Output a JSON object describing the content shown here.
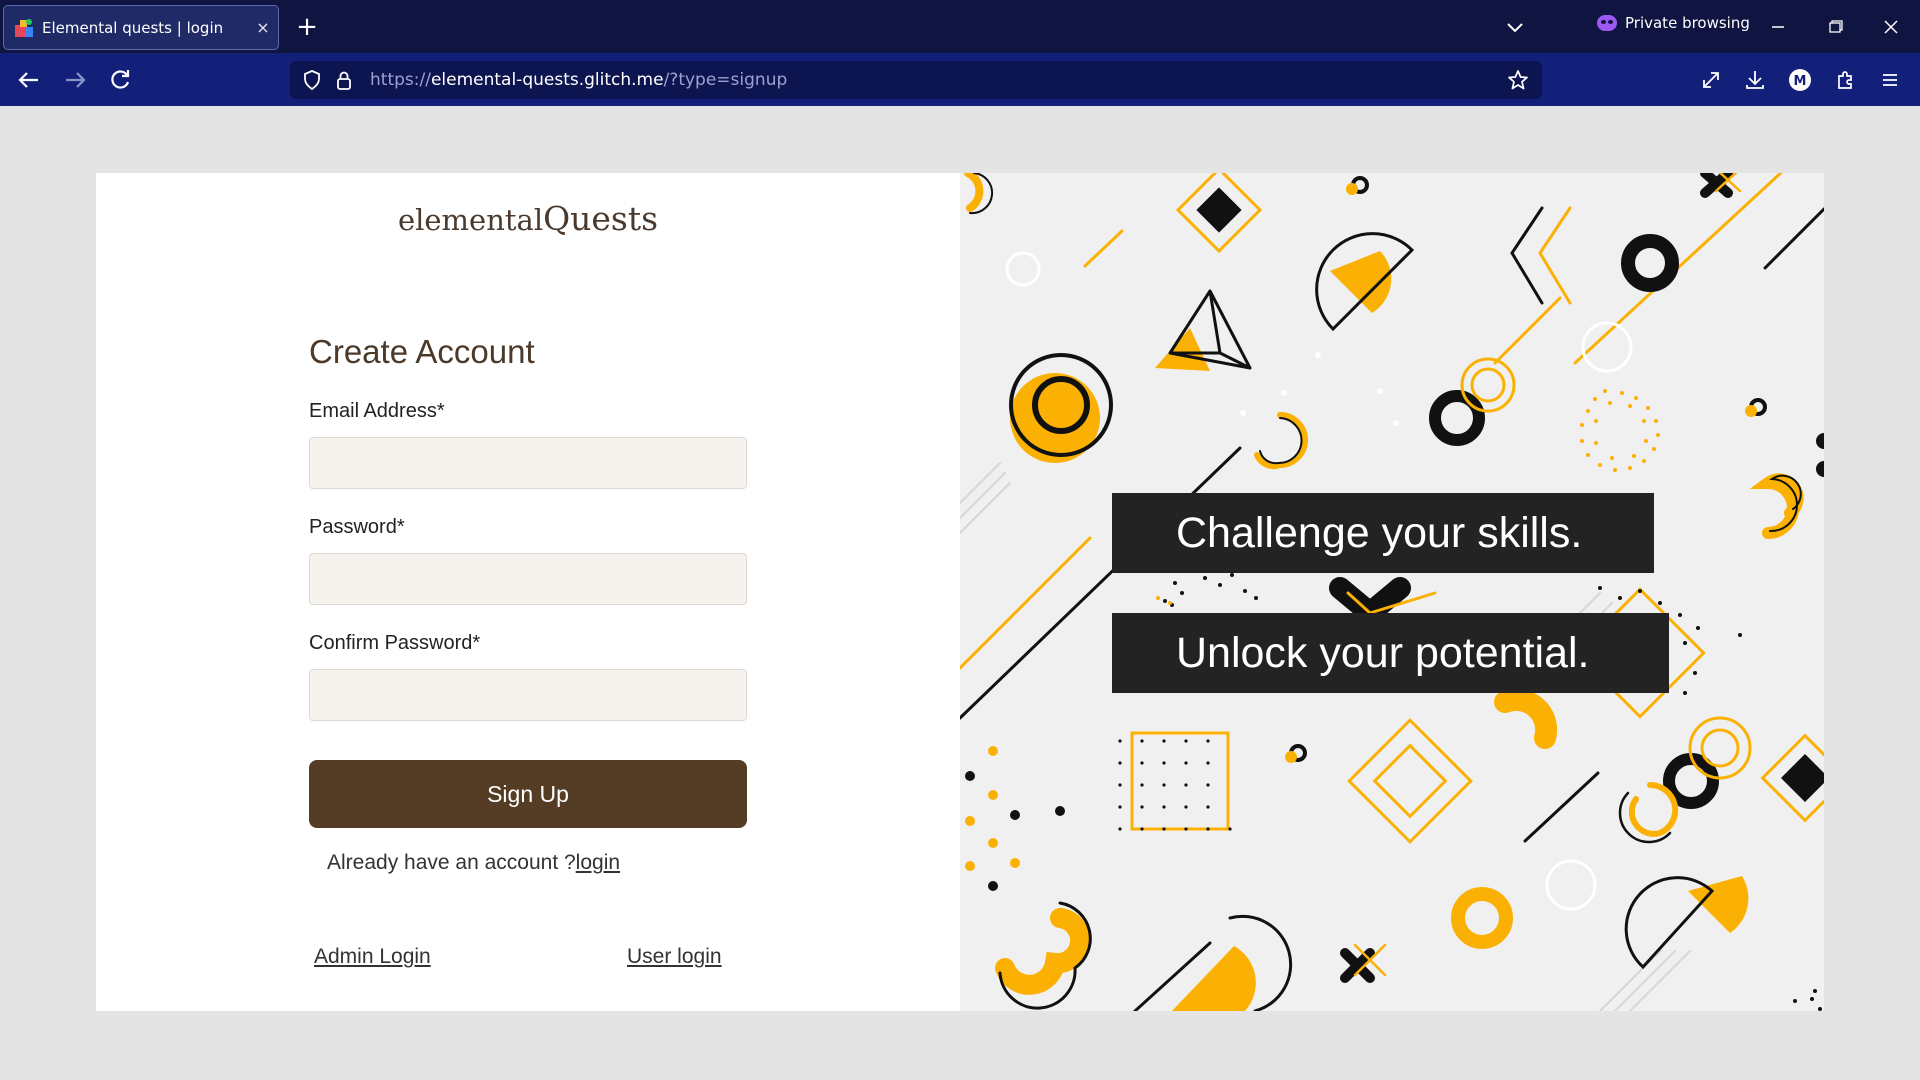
{
  "browser": {
    "tab_title": "Elemental quests | login",
    "tab_close": "×",
    "new_tab": "+",
    "private_label": "Private browsing",
    "url_prefix": "https://",
    "url_domain": "elemental-quests.glitch.me",
    "url_path": "/?type=signup",
    "account_initial": "M"
  },
  "brand": {
    "logo_small": "elemental",
    "logo_big": "Quests"
  },
  "form": {
    "heading": "Create Account",
    "email_label": "Email Address*",
    "email_value": "",
    "password_label": "Password*",
    "password_value": "",
    "confirm_label": "Confirm Password*",
    "confirm_value": "",
    "submit_label": "Sign Up",
    "already_text": "Already have an account ?",
    "login_link": "login",
    "admin_login": "Admin Login",
    "user_login": "User login"
  },
  "hero": {
    "line1": "Challenge your skills.",
    "line2": "Unlock your potential."
  },
  "colors": {
    "accent_yellow": "#fbb104",
    "brown": "#553c25",
    "banner_bg": "#232323",
    "tabbar_bg": "#0f1440",
    "navbar_bg": "#13207a"
  }
}
